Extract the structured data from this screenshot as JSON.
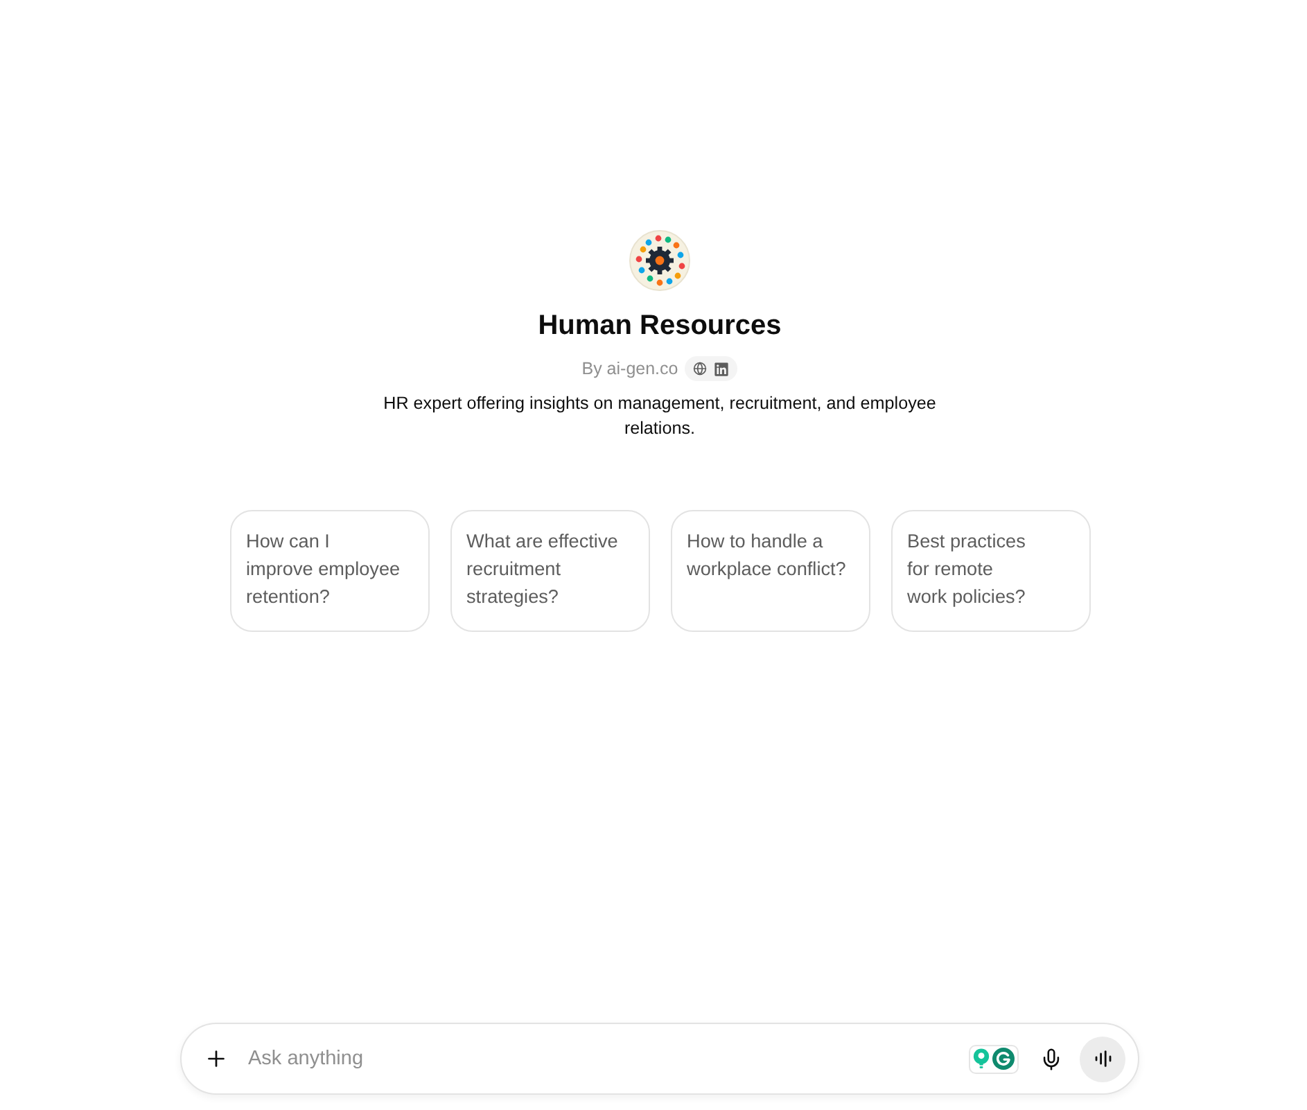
{
  "gpt": {
    "name": "Human Resources",
    "author": "By ai-gen.co",
    "description": "HR expert offering insights on management, recruitment, and employee relations."
  },
  "suggestions": [
    "How can I improve employee retention?",
    "What are effective recruitment strategies?",
    "How to handle a workplace conflict?",
    "Best practices for remote work policies?"
  ],
  "composer": {
    "placeholder": "Ask anything"
  }
}
